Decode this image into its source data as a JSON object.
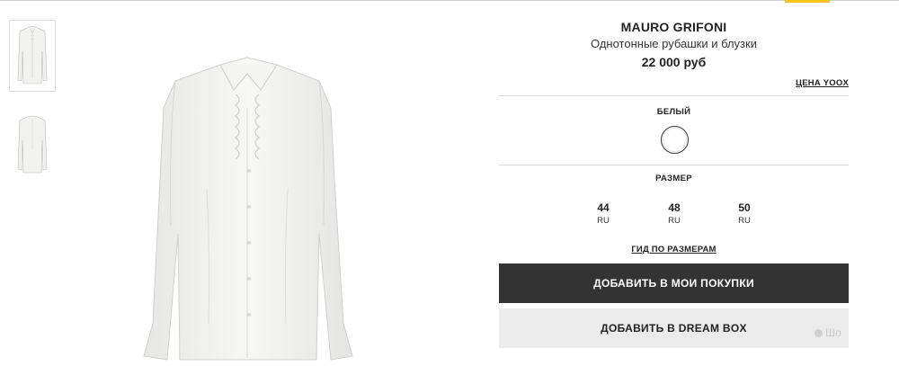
{
  "product": {
    "brand": "MAURO GRIFONI",
    "category": "Однотонные рубашки и блузки",
    "price": "22 000 руб",
    "price_link": "ЦЕНА YOOX"
  },
  "color": {
    "label": "БЕЛЫЙ",
    "swatch_hex": "#ffffff"
  },
  "size": {
    "label": "РАЗМЕР",
    "options": [
      {
        "value": "44",
        "unit": "RU"
      },
      {
        "value": "48",
        "unit": "RU"
      },
      {
        "value": "50",
        "unit": "RU"
      }
    ],
    "guide_link": "ГИД ПО РАЗМЕРАМ"
  },
  "actions": {
    "add_to_cart": "ДОБАВИТЬ В МОИ ПОКУПКИ",
    "add_to_dream_box": "ДОБАВИТЬ В DREAM BOX"
  },
  "gallery": {
    "thumbnails": [
      "shirt-front",
      "shirt-back"
    ],
    "active_index": 0
  },
  "watermark": "Шо",
  "colors": {
    "accent": "#f5c518",
    "primary_button": "#333333",
    "secondary_button": "#ebebeb"
  }
}
